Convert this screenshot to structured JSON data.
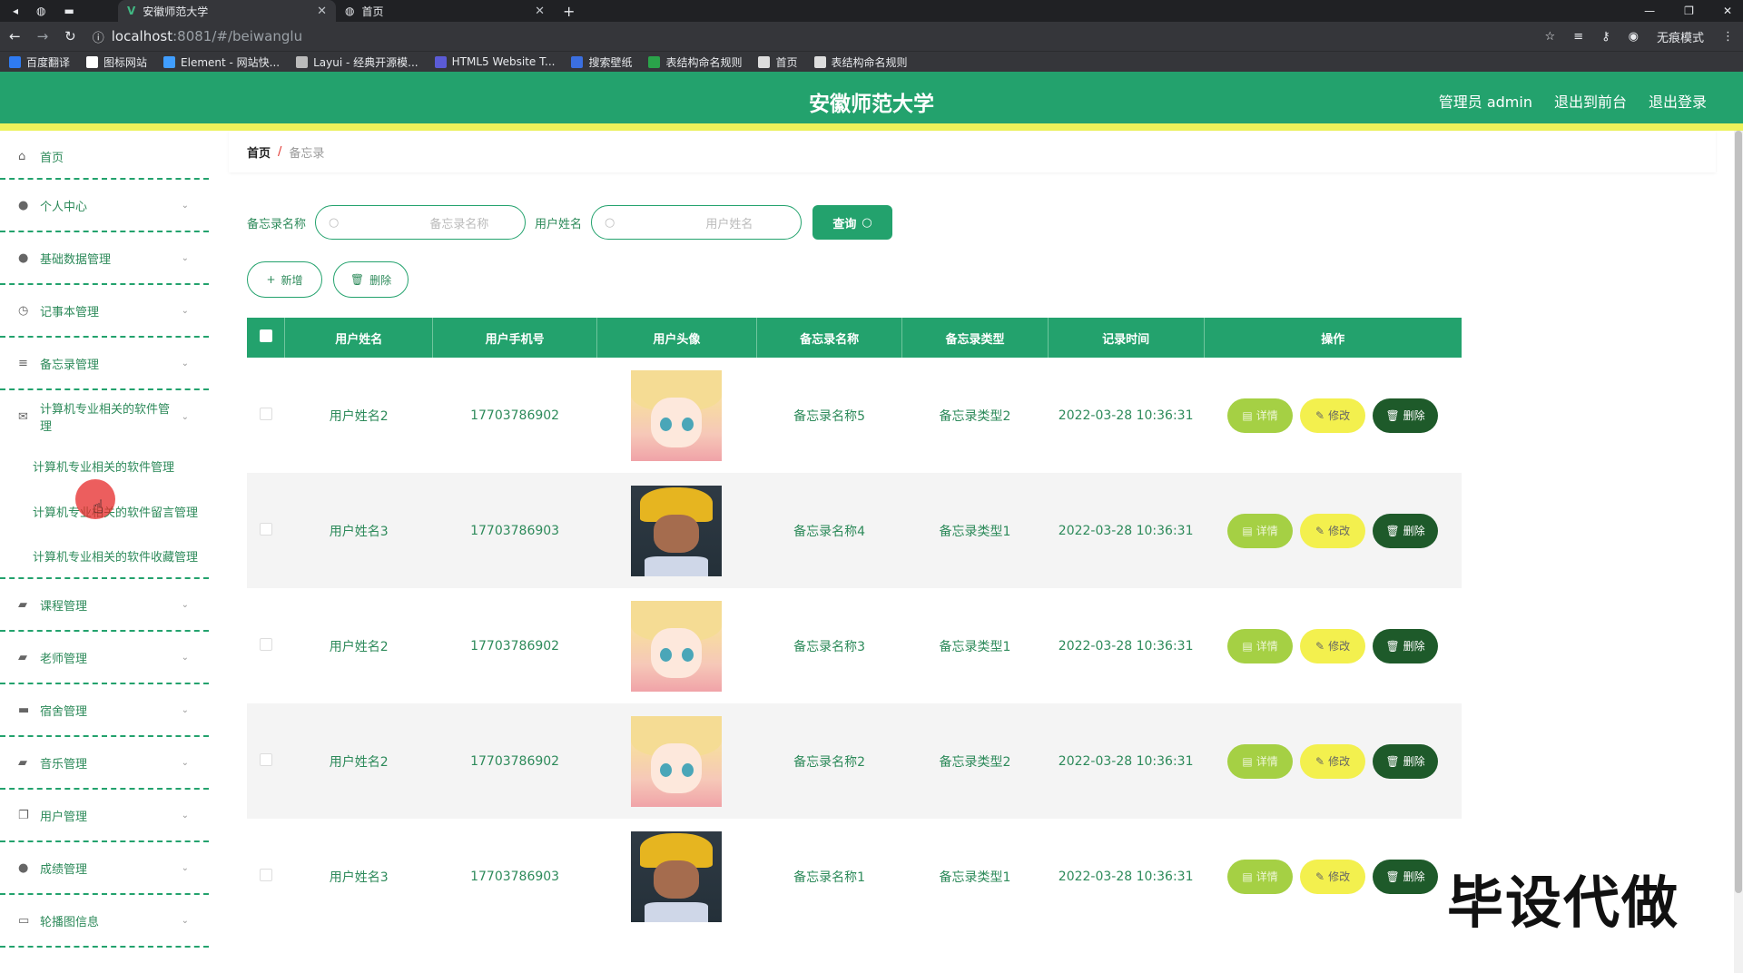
{
  "browser": {
    "tabs": [
      {
        "title": "安徽师范大学",
        "active": true
      },
      {
        "title": "首页",
        "active": false
      }
    ],
    "url_host": "localhost",
    "url_path": ":8081/#/beiwanglu",
    "incognito_label": "无痕模式",
    "bookmarks": [
      {
        "label": "百度翻译",
        "color": "#2f7bf2"
      },
      {
        "label": "图标网站",
        "color": "#ffffff"
      },
      {
        "label": "Element - 网站快...",
        "color": "#409eff"
      },
      {
        "label": "Layui - 经典开源模...",
        "color": "#bbbbbb"
      },
      {
        "label": "HTML5 Website T...",
        "color": "#5b5bd6"
      },
      {
        "label": "搜索壁纸",
        "color": "#3b6fe0"
      },
      {
        "label": "表结构命名规则",
        "color": "#2aa34a"
      },
      {
        "label": "首页",
        "color": "#dddddd"
      },
      {
        "label": "表结构命名规则",
        "color": "#dddddd"
      }
    ]
  },
  "header": {
    "brand": "安徽师范大学",
    "admin": "管理员 admin",
    "back_front": "退出到前台",
    "logout": "退出登录",
    "accent": "#23a26d",
    "stripe": "#ecf25a"
  },
  "sidebar": {
    "items": [
      {
        "label": "首页",
        "icon": "home-icon"
      },
      {
        "label": "个人中心",
        "icon": "user-icon"
      },
      {
        "label": "基础数据管理",
        "icon": "user-icon"
      },
      {
        "label": "记事本管理",
        "icon": "clock-icon"
      },
      {
        "label": "备忘录管理",
        "icon": "sliders-icon"
      },
      {
        "label": "计算机专业相关的软件管理",
        "icon": "mail-icon"
      }
    ],
    "subitems": [
      "计算机专业相关的软件管理",
      "计算机专业相关的软件留言管理",
      "计算机专业相关的软件收藏管理"
    ],
    "items_after": [
      {
        "label": "课程管理",
        "icon": "briefcase-icon"
      },
      {
        "label": "老师管理",
        "icon": "folder-icon"
      },
      {
        "label": "宿舍管理",
        "icon": "bed-icon"
      },
      {
        "label": "音乐管理",
        "icon": "music-icon"
      },
      {
        "label": "用户管理",
        "icon": "copy-icon"
      },
      {
        "label": "成绩管理",
        "icon": "user-icon"
      },
      {
        "label": "轮播图信息",
        "icon": "image-icon"
      }
    ]
  },
  "breadcrumb": {
    "home": "首页",
    "sep": "/",
    "current": "备忘录"
  },
  "search": {
    "label1": "备忘录名称",
    "placeholder1": "备忘录名称",
    "label2": "用户姓名",
    "placeholder2": "用户姓名",
    "query": "查询"
  },
  "actions": {
    "add": "新增",
    "delete": "删除"
  },
  "table": {
    "headers": [
      "用户姓名",
      "用户手机号",
      "用户头像",
      "备忘录名称",
      "备忘录类型",
      "记录时间",
      "操作"
    ],
    "ops": {
      "detail": "详情",
      "edit": "修改",
      "delete": "删除"
    },
    "rows": [
      {
        "name": "用户姓名2",
        "phone": "17703786902",
        "avatar": "girl",
        "memo": "备忘录名称5",
        "type": "备忘录类型2",
        "time": "2022-03-28 10:36:31"
      },
      {
        "name": "用户姓名3",
        "phone": "17703786903",
        "avatar": "boy",
        "memo": "备忘录名称4",
        "type": "备忘录类型1",
        "time": "2022-03-28 10:36:31"
      },
      {
        "name": "用户姓名2",
        "phone": "17703786902",
        "avatar": "girl",
        "memo": "备忘录名称3",
        "type": "备忘录类型1",
        "time": "2022-03-28 10:36:31"
      },
      {
        "name": "用户姓名2",
        "phone": "17703786902",
        "avatar": "girl",
        "memo": "备忘录名称2",
        "type": "备忘录类型2",
        "time": "2022-03-28 10:36:31"
      },
      {
        "name": "用户姓名3",
        "phone": "17703786903",
        "avatar": "boy",
        "memo": "备忘录名称1",
        "type": "备忘录类型1",
        "time": "2022-03-28 10:36:31"
      }
    ]
  },
  "watermark": "毕设代做"
}
